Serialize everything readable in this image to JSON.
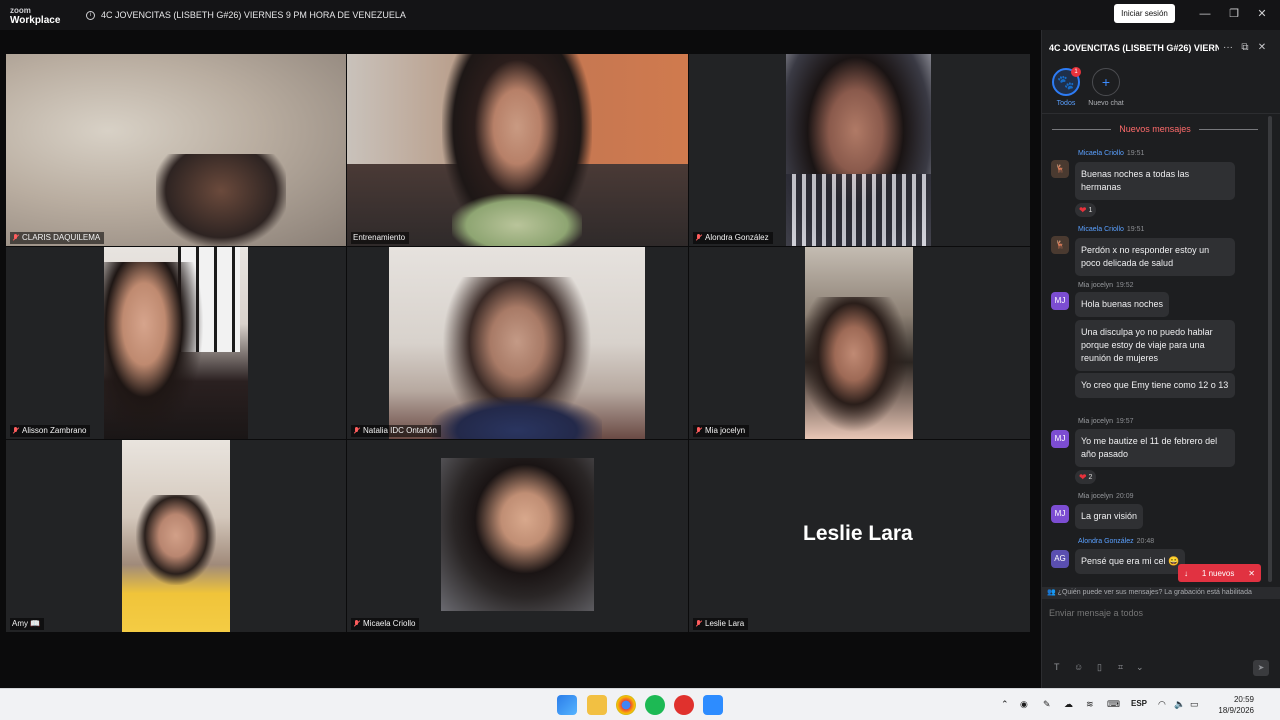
{
  "window": {
    "logo_line1": "zoom",
    "logo_line2": "Workplace",
    "meeting_title": "4C JOVENCITAS (LISBETH G#26) VIERNES 9 PM HORA DE VENEZUELA",
    "signin_label": "Iniciar sesión",
    "minimize": "—",
    "maximize": "❐",
    "close": "✕"
  },
  "gallery": {
    "participants": [
      {
        "name": "CLARIS DAQUILEMA",
        "muted": true
      },
      {
        "name": "Entrenamiento",
        "muted": false,
        "active_speaker": true
      },
      {
        "name": "Alondra González",
        "muted": true
      },
      {
        "name": "Alisson Zambrano",
        "muted": true
      },
      {
        "name": "Natalia IDC Ontañón",
        "muted": true
      },
      {
        "name": "Mia jocelyn",
        "muted": true
      },
      {
        "name": "Amy 📖",
        "muted": false
      },
      {
        "name": "Micaela Criollo",
        "muted": true
      },
      {
        "name": "Leslie Lara",
        "muted": true,
        "video_off": true
      }
    ],
    "video_off_name": "Leslie Lara"
  },
  "chat": {
    "title": "4C JOVENCITAS (LISBETH G#26) VIERN...",
    "header_icons": {
      "more": "···",
      "popout": "⧉",
      "close": "✕"
    },
    "tabs": [
      {
        "label": "Todos",
        "badge": "1",
        "icon": "paw-icon"
      },
      {
        "label": "Nuevo chat",
        "icon": "plus-icon"
      }
    ],
    "new_messages_divider": "Nuevos mensajes",
    "messages": [
      {
        "sender": "Micaela Criollo",
        "time": "19:51",
        "text": "Buenas noches a todas las hermanas",
        "reaction": "1"
      },
      {
        "sender": "Micaela Criollo",
        "time": "19:51",
        "text": "Perdón x no responder estoy un poco delicada de salud"
      },
      {
        "sender": "Mia jocelyn",
        "time": "19:52",
        "initials": "MJ",
        "text": "Hola buenas noches"
      },
      {
        "text": "Una disculpa yo no puedo hablar porque estoy de viaje para una reunión de mujeres"
      },
      {
        "text": "Yo creo que Emy tiene como 12 o 13"
      },
      {
        "sender": "Mia jocelyn",
        "time": "19:57",
        "initials": "MJ",
        "text": "Yo me bautize el 11 de febrero del año pasado",
        "reaction": "2"
      },
      {
        "sender": "Mia jocelyn",
        "time": "20:09",
        "initials": "MJ",
        "text": "La gran visión"
      },
      {
        "sender": "Alondra González",
        "time": "20:48",
        "initials": "AG",
        "text": "Pensé que era mi cel 😀"
      }
    ],
    "new_button_label": "1 nuevos",
    "recording_notice": "¿Quién puede ver sus mensajes? La grabación está habilitada",
    "compose_placeholder": "Enviar mensaje a todos"
  },
  "taskbar": {
    "language": "ESP",
    "time": "20:59",
    "date": "18/9/2026"
  }
}
